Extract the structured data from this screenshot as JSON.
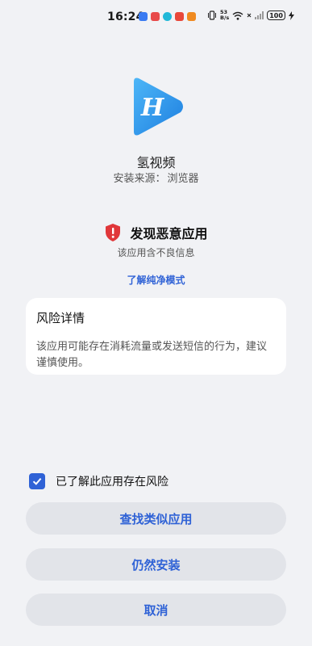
{
  "status_bar": {
    "time": "16:24",
    "net_speed_value": "53",
    "net_speed_unit": "B/s",
    "battery": "100",
    "notification_colors": [
      "#3a7bf2",
      "#e84a4a",
      "#20b8d8",
      "#e8483a",
      "#f08a20"
    ]
  },
  "app": {
    "name": "氢视频",
    "source_label": "安装来源：",
    "source_value": "浏览器",
    "logo_letter": "H",
    "logo_colors": [
      "#3fa9f5",
      "#1e7fe0"
    ]
  },
  "warning": {
    "title": "发现恶意应用",
    "subtitle": "该应用含不良信息",
    "link": "了解纯净模式",
    "icon_color": "#e0373a"
  },
  "risk": {
    "title": "风险详情",
    "description": "该应用可能存在消耗流量或发送短信的行为，建议谨慎使用。"
  },
  "agree": {
    "label": "已了解此应用存在风险",
    "checked": true
  },
  "buttons": {
    "find_similar": "查找类似应用",
    "install_anyway": "仍然安装",
    "cancel": "取消"
  },
  "accent": "#2f62d6"
}
